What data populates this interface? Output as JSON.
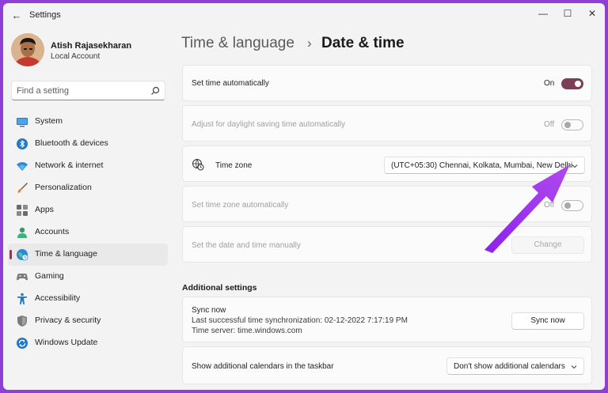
{
  "window": {
    "app_title": "Settings",
    "back_glyph": "←",
    "minimize_glyph": "—",
    "maximize_glyph": "☐",
    "close_glyph": "✕"
  },
  "profile": {
    "name": "Atish Rajasekharan",
    "account_type": "Local Account"
  },
  "search": {
    "placeholder": "Find a setting"
  },
  "sidebar": {
    "items": [
      {
        "label": "System",
        "icon": "system-icon"
      },
      {
        "label": "Bluetooth & devices",
        "icon": "bluetooth-icon"
      },
      {
        "label": "Network & internet",
        "icon": "wifi-icon"
      },
      {
        "label": "Personalization",
        "icon": "brush-icon"
      },
      {
        "label": "Apps",
        "icon": "apps-icon"
      },
      {
        "label": "Accounts",
        "icon": "person-icon"
      },
      {
        "label": "Time & language",
        "icon": "globe-clock-icon",
        "active": true
      },
      {
        "label": "Gaming",
        "icon": "gamepad-icon"
      },
      {
        "label": "Accessibility",
        "icon": "accessibility-icon"
      },
      {
        "label": "Privacy & security",
        "icon": "shield-icon"
      },
      {
        "label": "Windows Update",
        "icon": "update-icon"
      }
    ]
  },
  "breadcrumb": {
    "parent": "Time & language",
    "separator": "›",
    "current": "Date & time"
  },
  "settings": {
    "set_time_auto": {
      "label": "Set time automatically",
      "state": "On"
    },
    "dst_auto": {
      "label": "Adjust for daylight saving time automatically",
      "state": "Off"
    },
    "time_zone": {
      "label": "Time zone",
      "value": "(UTC+05:30) Chennai, Kolkata, Mumbai, New Delhi"
    },
    "tz_auto": {
      "label": "Set time zone automatically",
      "state": "Off"
    },
    "manual": {
      "label": "Set the date and time manually",
      "button": "Change"
    }
  },
  "additional": {
    "title": "Additional settings",
    "sync": {
      "label": "Sync now",
      "last_sync": "Last successful time synchronization: 02-12-2022 7:17:19 PM",
      "server": "Time server: time.windows.com",
      "button": "Sync now"
    },
    "calendars": {
      "label": "Show additional calendars in the taskbar",
      "value": "Don't show additional calendars"
    }
  },
  "colors": {
    "accent": "#7d3e57",
    "background_frame": "#8e3fd6",
    "annotation_arrow": "#9b30e8"
  }
}
